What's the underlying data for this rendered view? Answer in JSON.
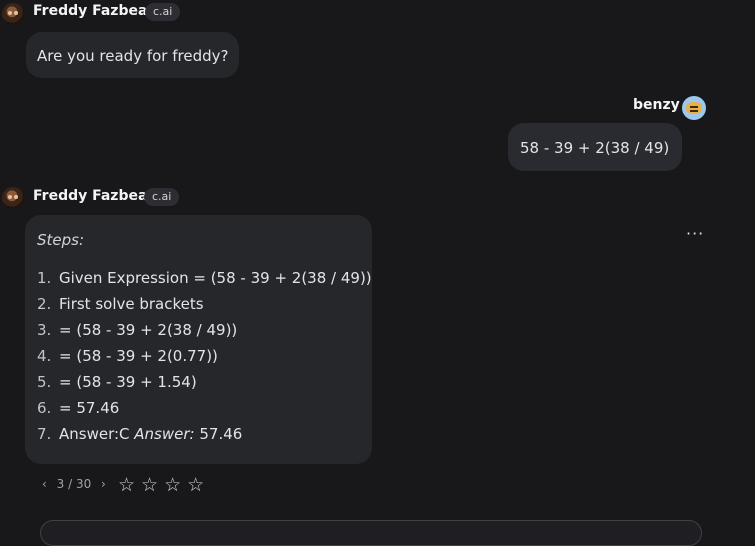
{
  "messages": {
    "first": {
      "author": "Freddy Fazbear",
      "badge": "c.ai",
      "text": "Are you ready for freddy?"
    },
    "user": {
      "author": "benzy",
      "text": "58 - 39 + 2(38 / 49)"
    },
    "reply": {
      "author": "Freddy Fazbear",
      "badge": "c.ai",
      "steps_title": "Steps:",
      "steps": [
        {
          "n": "1.",
          "text": "Given Expression = (58 - 39 + 2(38 / 49))"
        },
        {
          "n": "2.",
          "text": "First solve brackets"
        },
        {
          "n": "3.",
          "text": "= (58 - 39 + 2(38 / 49))"
        },
        {
          "n": "4.",
          "text": "= (58 - 39 + 2(0.77))"
        },
        {
          "n": "5.",
          "text": "= (58 - 39 + 1.54)"
        },
        {
          "n": "6.",
          "text": "= 57.46"
        }
      ],
      "answer_step": {
        "n": "7.",
        "prefix": "Answer:C ",
        "italic": "Answer:",
        "value": " 57.46"
      }
    }
  },
  "controls": {
    "more_icon": "more-horizontal-icon",
    "pager": {
      "prev": "‹",
      "current": "3 / 30",
      "next": "›"
    },
    "stars": "☆☆☆☆",
    "rating_of": 4
  }
}
